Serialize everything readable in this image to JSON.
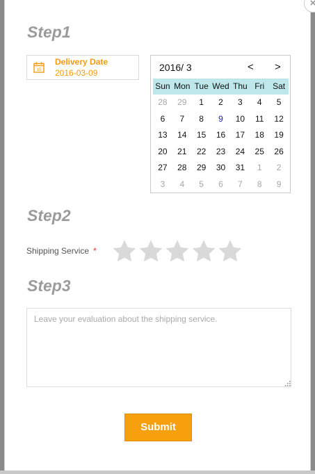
{
  "close": {
    "label": "×"
  },
  "step1": {
    "title": "Step1",
    "delivery": {
      "label": "Delivery Date",
      "value": "2016-03-09",
      "icon": "calendar-icon"
    }
  },
  "calendar": {
    "month_label": "2016/ 3",
    "prev_label": "<",
    "next_label": ">",
    "weekdays": [
      "Sun",
      "Mon",
      "Tue",
      "Wed",
      "Thu",
      "Fri",
      "Sat"
    ],
    "days": [
      {
        "d": "28",
        "muted": true
      },
      {
        "d": "29",
        "muted": true
      },
      {
        "d": "1"
      },
      {
        "d": "2"
      },
      {
        "d": "3"
      },
      {
        "d": "4"
      },
      {
        "d": "5"
      },
      {
        "d": "6"
      },
      {
        "d": "7"
      },
      {
        "d": "8"
      },
      {
        "d": "9",
        "today": true
      },
      {
        "d": "10"
      },
      {
        "d": "11"
      },
      {
        "d": "12"
      },
      {
        "d": "13"
      },
      {
        "d": "14"
      },
      {
        "d": "15"
      },
      {
        "d": "16"
      },
      {
        "d": "17"
      },
      {
        "d": "18"
      },
      {
        "d": "19"
      },
      {
        "d": "20"
      },
      {
        "d": "21"
      },
      {
        "d": "22"
      },
      {
        "d": "23"
      },
      {
        "d": "24"
      },
      {
        "d": "25"
      },
      {
        "d": "26"
      },
      {
        "d": "27"
      },
      {
        "d": "28"
      },
      {
        "d": "29"
      },
      {
        "d": "30"
      },
      {
        "d": "31"
      },
      {
        "d": "1",
        "muted": true
      },
      {
        "d": "2",
        "muted": true
      },
      {
        "d": "3",
        "muted": true
      },
      {
        "d": "4",
        "muted": true
      },
      {
        "d": "5",
        "muted": true
      },
      {
        "d": "6",
        "muted": true
      },
      {
        "d": "7",
        "muted": true
      },
      {
        "d": "8",
        "muted": true
      },
      {
        "d": "9",
        "muted": true
      }
    ]
  },
  "step2": {
    "title": "Step2",
    "shipping_label": "Shipping Service",
    "required_mark": "*",
    "rating": {
      "value": 0,
      "max": 5,
      "star_color": "#d9d9d9"
    }
  },
  "step3": {
    "title": "Step3",
    "evaluation_placeholder": "Leave your evaluation about the shipping service.",
    "evaluation_value": ""
  },
  "submit": {
    "label": "Submit",
    "color": "#f5a00c"
  },
  "colors": {
    "accent": "#f59a0d",
    "weekday_bg": "#bde7ea",
    "step_title": "#9b9b9b"
  }
}
